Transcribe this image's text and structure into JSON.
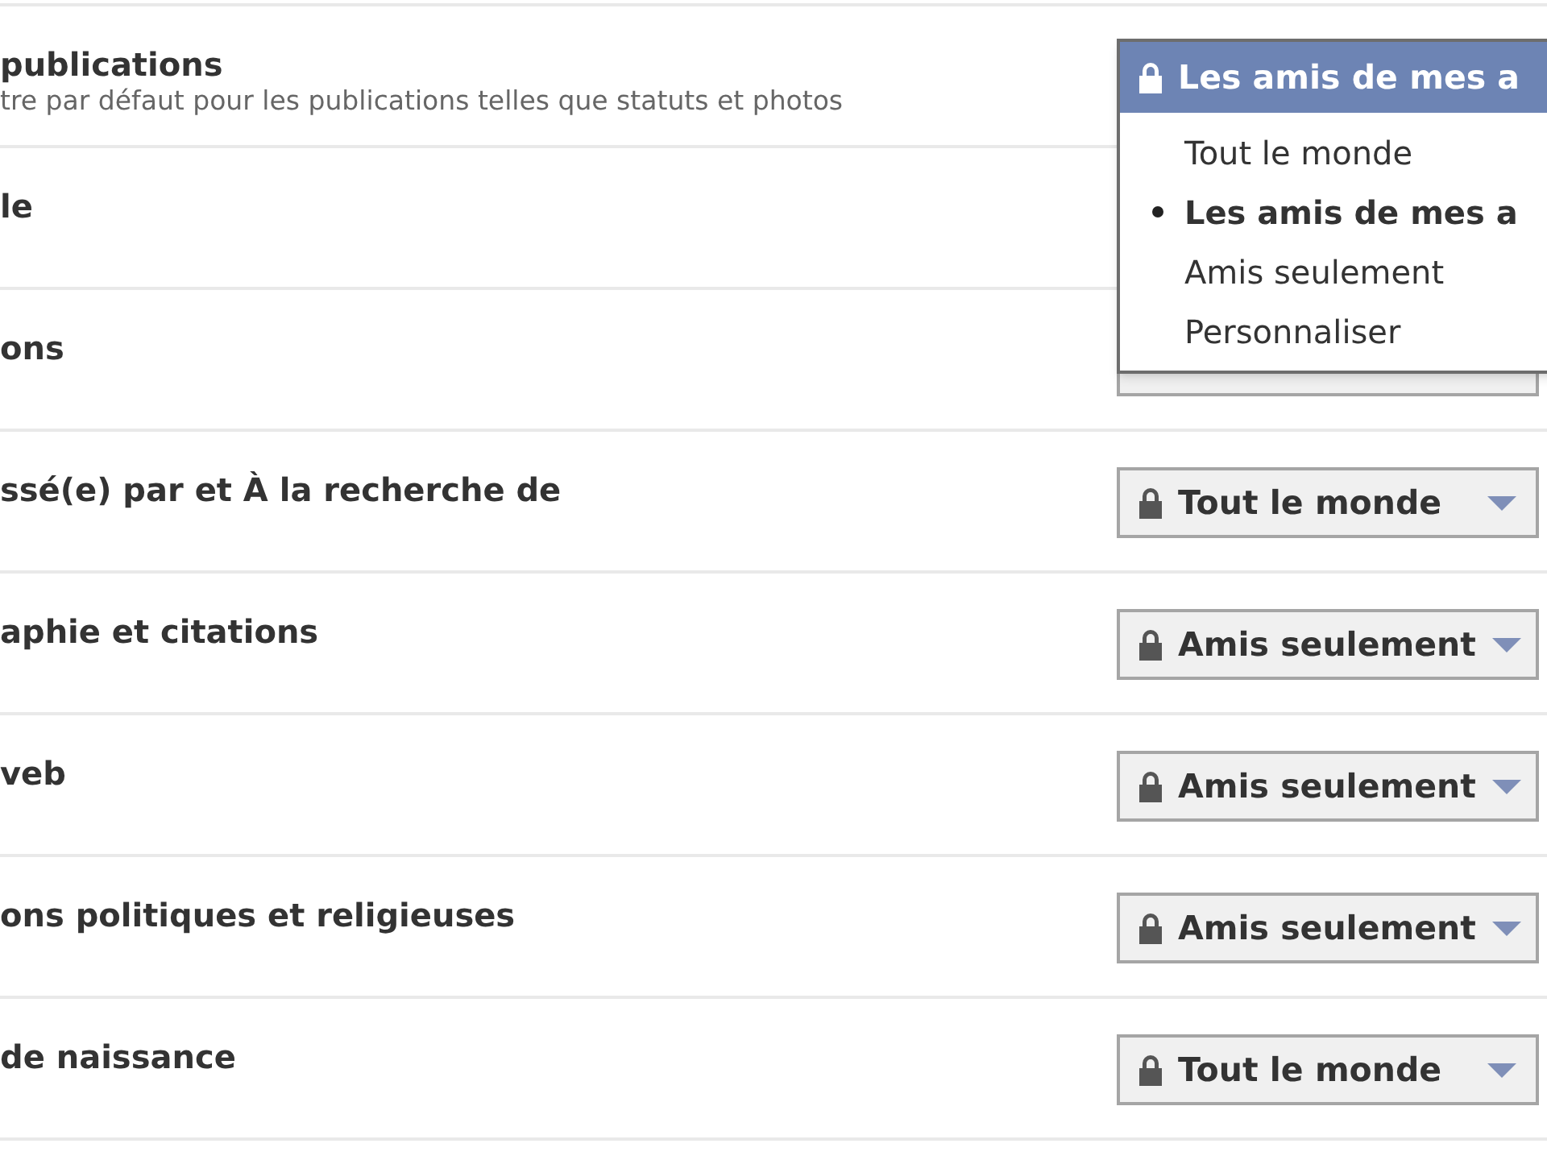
{
  "settings": [
    {
      "title": "publications",
      "subtitle": "tre par défaut pour les publications telles que statuts et photos",
      "value": "Les amis de mes a",
      "menu": [
        {
          "label": "Tout le monde",
          "selected": false
        },
        {
          "label": "Les amis de mes a",
          "selected": true
        },
        {
          "label": "Amis seulement",
          "selected": false
        },
        {
          "label": "Personnaliser",
          "selected": false
        }
      ]
    },
    {
      "title": "le"
    },
    {
      "title": "ons"
    },
    {
      "title": "ssé(e) par et À la recherche de",
      "value": "Tout le monde"
    },
    {
      "title": "aphie et citations",
      "value": "Amis seulement"
    },
    {
      "title": "veb",
      "value": "Amis seulement"
    },
    {
      "title": "ons politiques et religieuses",
      "value": "Amis seulement"
    },
    {
      "title": "de naissance",
      "value": "Tout le monde"
    }
  ]
}
